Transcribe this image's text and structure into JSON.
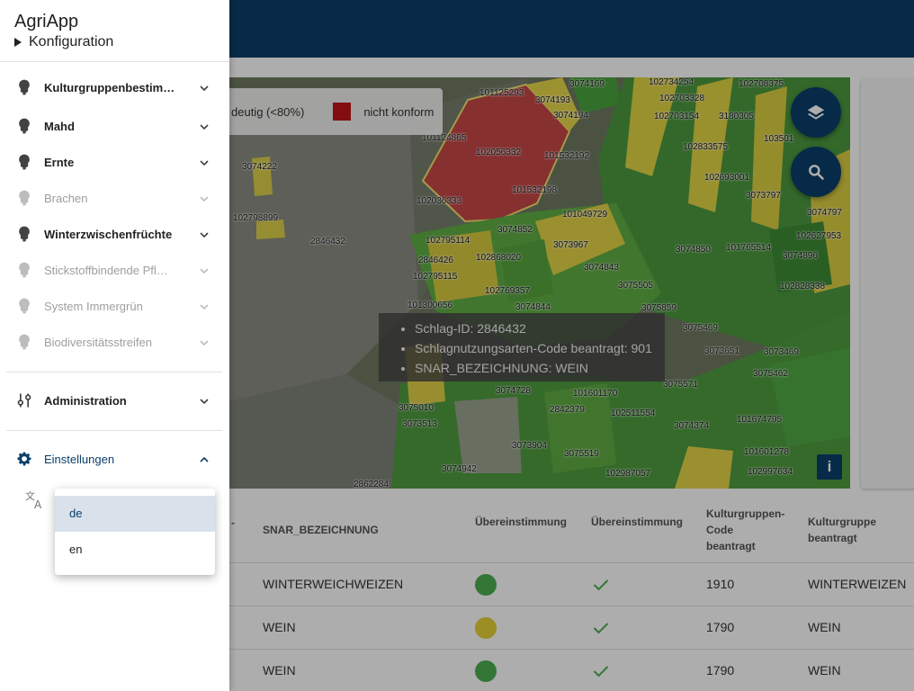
{
  "drawer": {
    "title": "AgriApp",
    "subtitle": "Konfiguration",
    "items": [
      {
        "label": "Kulturgruppenbestim…",
        "enabled": true
      },
      {
        "label": "Mahd",
        "enabled": true
      },
      {
        "label": "Ernte",
        "enabled": true
      },
      {
        "label": "Brachen",
        "enabled": false
      },
      {
        "label": "Winterzwischenfrüchte",
        "enabled": true
      },
      {
        "label": "Stickstoffbindende Pfl…",
        "enabled": false
      },
      {
        "label": "System Immergrün",
        "enabled": false
      },
      {
        "label": "Biodiversitätsstreifen",
        "enabled": false
      }
    ],
    "administration": "Administration",
    "settings": "Einstellungen"
  },
  "language_menu": {
    "options": [
      "de",
      "en"
    ],
    "selected": "de"
  },
  "map": {
    "legend_partial": "deutig (<80%)",
    "legend_nonconform": "nicht konform",
    "legend_nonconform_color": "#c0151b",
    "tooltip": [
      "Schlag-ID: 2846432",
      "Schlagnutzungsarten-Code beantragt: 901",
      "SNAR_BEZEICHNUNG: WEIN"
    ],
    "info_button": "i",
    "parcel_labels": [
      "101125293",
      "3074193",
      "3074169",
      "102734254",
      "102708375",
      "102703328",
      "3074194",
      "102703154",
      "3180305",
      "101124865",
      "102056332",
      "101532192",
      "3074222",
      "102833575",
      "103501",
      "102693001",
      "3073797",
      "102036333",
      "101532198",
      "101049729",
      "3074797",
      "102798899",
      "3074852",
      "3073967",
      "3074850",
      "101765514",
      "102627953",
      "2846426",
      "102795114",
      "102868020",
      "3074843",
      "2846432",
      "102795115",
      "102769357",
      "3075505",
      "101300656",
      "3074844",
      "3075859",
      "3075469",
      "3073651",
      "3073469",
      "3075462",
      "3075010",
      "3073513",
      "3074728",
      "101601170",
      "2842379",
      "102511554",
      "101674795",
      "3073904",
      "3075519",
      "3074942",
      "102987057",
      "101601278",
      "102997634",
      "2862284",
      "3074896",
      "102828338",
      "3075571",
      "3074374"
    ]
  },
  "table": {
    "headers": [
      "SNAR_BEZEICHNUNG",
      "Übereinstimmung",
      "Übereinstimmung",
      "Kulturgruppen-\nCode\nbeantragt",
      "Kulturgruppe\nbeantragt"
    ],
    "rows": [
      {
        "snar": "WINTERWEICHWEIZEN",
        "match_color": "#4caf50",
        "code": "1910",
        "group": "WINTERWEIZEN"
      },
      {
        "snar": "WEIN",
        "match_color": "#e3d136",
        "code": "1790",
        "group": "WEIN"
      },
      {
        "snar": "WEIN",
        "match_color": "#4caf50",
        "code": "1790",
        "group": "WEIN"
      }
    ]
  },
  "colors": {
    "primary": "#0b3f6b",
    "check": "#4caf50"
  }
}
